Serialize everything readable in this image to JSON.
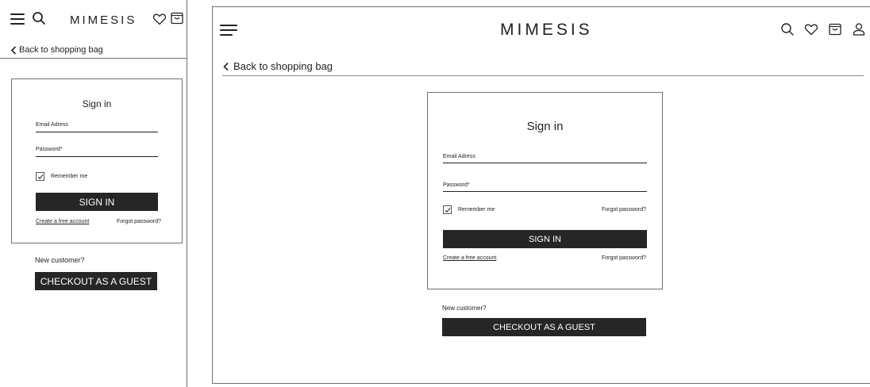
{
  "brand": "MIMESIS",
  "back_link": "Back to shopping bag",
  "signin": {
    "title": "Sign in",
    "email_label": "Email Adress",
    "password_label": "Password*",
    "remember_label": "Remember me",
    "remember_checked": true,
    "submit_label": "SIGN IN",
    "create_account": "Create a free account",
    "forgot_password": "Forgot password?"
  },
  "guest": {
    "prompt": "New customer?",
    "button_label": "CHECKOUT AS A GUEST"
  },
  "icons": {
    "menu": "hamburger-menu-icon",
    "search": "search-icon",
    "wishlist": "heart-icon",
    "bag": "shopping-bag-icon",
    "account": "user-icon",
    "back": "chevron-left-icon",
    "check": "checkmark-icon"
  },
  "colors": {
    "button_bg": "#262626",
    "button_text": "#ffffff",
    "border": "#6f6f6f",
    "text": "#222222"
  }
}
